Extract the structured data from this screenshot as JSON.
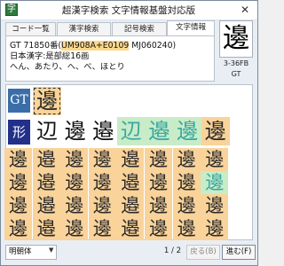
{
  "window": {
    "title": "超漢字検索 文字情報基盤対応版",
    "close_label": "✕"
  },
  "tabs": [
    "コード一覧",
    "漢字検索",
    "記号検索",
    "文字情報"
  ],
  "info": {
    "line1_prefix": "GT 71850番(",
    "line1_highlight": "UM908A+E0109",
    "line1_suffix": " MJ060240)",
    "line2": "日本漢字:是部総16画",
    "line3": "へん、あたり、へ、べ、ほとり"
  },
  "glyph": {
    "char": "邊",
    "code": "3-36FB",
    "source": "GT"
  },
  "badges": {
    "gt": "GT",
    "kei": "形"
  },
  "grid": {
    "row0": [
      {
        "ch": "邊",
        "style": "o",
        "sel": true
      }
    ],
    "row1": [
      {
        "ch": "辺",
        "style": "w"
      },
      {
        "ch": "邊",
        "style": "w"
      },
      {
        "ch": "邉",
        "style": "w"
      },
      {
        "ch": "辺",
        "style": "g"
      },
      {
        "ch": "邉",
        "style": "g"
      },
      {
        "ch": "邊",
        "style": "g"
      },
      {
        "ch": "邊",
        "style": "o"
      }
    ],
    "rows": [
      [
        {
          "ch": "邊",
          "style": "o"
        },
        {
          "ch": "邉",
          "style": "o"
        },
        {
          "ch": "邊",
          "style": "o"
        },
        {
          "ch": "邊",
          "style": "o"
        },
        {
          "ch": "邉",
          "style": "o"
        },
        {
          "ch": "邊",
          "style": "o"
        },
        {
          "ch": "邊",
          "style": "o"
        },
        {
          "ch": "邊",
          "style": "o"
        }
      ],
      [
        {
          "ch": "邊",
          "style": "o"
        },
        {
          "ch": "邉",
          "style": "o"
        },
        {
          "ch": "邊",
          "style": "o"
        },
        {
          "ch": "邊",
          "style": "o"
        },
        {
          "ch": "邉",
          "style": "o"
        },
        {
          "ch": "邊",
          "style": "o"
        },
        {
          "ch": "邊",
          "style": "o"
        },
        {
          "ch": "邊",
          "style": "g"
        }
      ],
      [
        {
          "ch": "邊",
          "style": "o"
        },
        {
          "ch": "邉",
          "style": "o"
        },
        {
          "ch": "邊",
          "style": "o"
        },
        {
          "ch": "邊",
          "style": "o"
        },
        {
          "ch": "邉",
          "style": "o"
        },
        {
          "ch": "邊",
          "style": "o"
        },
        {
          "ch": "邊",
          "style": "o"
        },
        {
          "ch": "邊",
          "style": "o"
        }
      ],
      [
        {
          "ch": "邊",
          "style": "o"
        },
        {
          "ch": "邉",
          "style": "o"
        },
        {
          "ch": "邊",
          "style": "o"
        },
        {
          "ch": "邊",
          "style": "o"
        },
        {
          "ch": "邉",
          "style": "o"
        },
        {
          "ch": "邊",
          "style": "o"
        },
        {
          "ch": "邊",
          "style": "o"
        },
        {
          "ch": "邊",
          "style": "o"
        }
      ]
    ]
  },
  "footer": {
    "font_select": "明朝体",
    "page": "1 / 2",
    "prev_label": "戻る(B)",
    "next_label": "進む(F)"
  },
  "colors": {
    "orange": "#f9d39a",
    "green": "#c8ecc8",
    "gt_badge": "#3a6ea8",
    "kei_badge": "#23308a"
  }
}
